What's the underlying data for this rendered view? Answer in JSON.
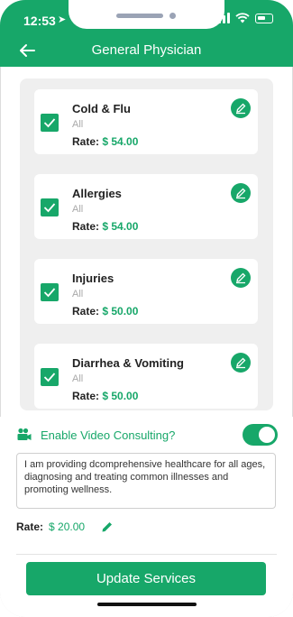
{
  "status_bar": {
    "time": "12:53"
  },
  "header": {
    "title": "General Physician"
  },
  "services": [
    {
      "name": "Cold & Flu",
      "category": "All",
      "rate_label": "Rate:",
      "rate_value": "$ 54.00"
    },
    {
      "name": "Allergies",
      "category": "All",
      "rate_label": "Rate:",
      "rate_value": "$ 54.00"
    },
    {
      "name": "Injuries",
      "category": "All",
      "rate_label": "Rate:",
      "rate_value": "$ 50.00"
    },
    {
      "name": "Diarrhea & Vomiting",
      "category": "All",
      "rate_label": "Rate:",
      "rate_value": "$ 50.00"
    }
  ],
  "video_consulting": {
    "label": "Enable Video Consulting?",
    "enabled": true,
    "description": "I am providing dcomprehensive healthcare for all ages, diagnosing and treating common illnesses and promoting wellness.",
    "rate_label": "Rate:",
    "rate_value": "$ 20.00"
  },
  "actions": {
    "update_label": "Update Services"
  },
  "colors": {
    "accent": "#17a769",
    "list_bg": "#efefef"
  },
  "icons": {
    "back": "arrow-left-icon",
    "check": "checkmark-icon",
    "edit": "pencil-icon",
    "video": "video-camera-icon"
  }
}
